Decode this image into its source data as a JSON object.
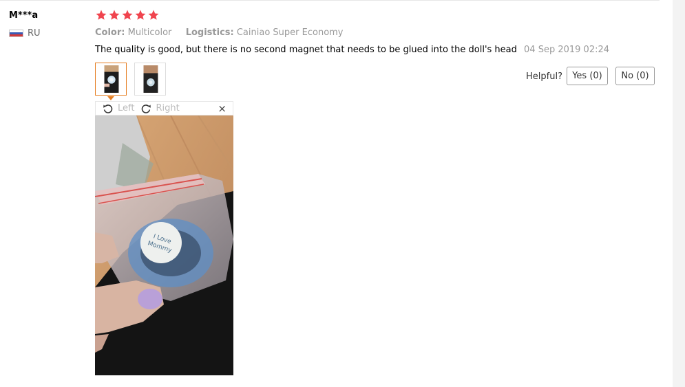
{
  "review": {
    "user_name": "M***a",
    "country": "RU",
    "rating": 5,
    "color_label": "Color:",
    "color_value": "Multicolor",
    "logistics_label": "Logistics:",
    "logistics_value": "Cainiao Super Economy",
    "text": "The quality is good, but there is no second magnet that needs to be glued into the doll's head",
    "date": "04 Sep 2019 02:24"
  },
  "helpful": {
    "label": "Helpful?",
    "yes_label": "Yes (0)",
    "no_label": "No (0)"
  },
  "viewer": {
    "left_label": "Left",
    "right_label": "Right",
    "close_glyph": "×"
  },
  "photo": {
    "sticker_text_line1": "I Love",
    "sticker_text_line2": "Mommy"
  },
  "colors": {
    "star": "#f0444e",
    "active_thumb_border": "#e67e22",
    "muted_text": "#999999"
  },
  "icons": [
    "flag-ru-icon",
    "star-icon",
    "rotate-left-icon",
    "rotate-right-icon",
    "close-icon"
  ]
}
